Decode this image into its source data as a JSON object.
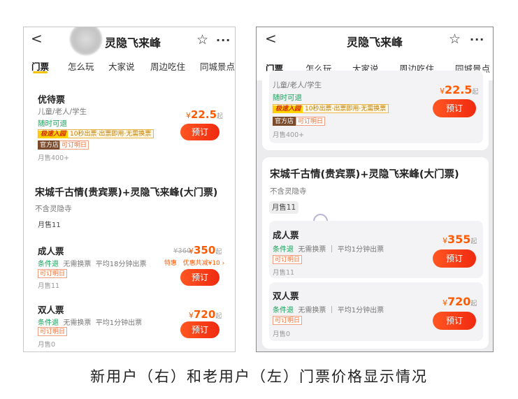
{
  "header": {
    "title": "灵隐飞来峰"
  },
  "tabs": [
    "门票",
    "怎么玩",
    "大家说",
    "周边吃住",
    "同城景点"
  ],
  "icons": {
    "back": "back-arrow-icon",
    "favorite": "star-icon",
    "more": "more-icon"
  },
  "colors": {
    "accent": "#f5c400",
    "price": "#ff5a00",
    "button": "#f0361a",
    "green": "#1aa05a"
  },
  "left": {
    "youdai": {
      "name": "优待票",
      "audience": "儿童/老人/学生",
      "refund": "随时可退",
      "fast_tag": "极速入园",
      "fast_text": "10秒出票·出票即用·无需换票",
      "shop": "官方店",
      "book": "可订明日",
      "sales": "月售400+",
      "currency": "¥",
      "price": "22.5",
      "unit": "起",
      "button": "预订"
    },
    "combo": {
      "title": "宋城千古情(贵宾票)+灵隐飞来峰(大门票)",
      "note": "不含灵隐寺",
      "sales": "月售11",
      "adult": {
        "name": "成人票",
        "refund": "条件退",
        "exchange": "无需换票",
        "speed": "平均18分钟出票",
        "book": "可订明日",
        "sales": "月售11",
        "orig": "¥360",
        "currency": "¥",
        "price": "350",
        "unit": "起",
        "special": "特惠",
        "discount": "优惠共减¥10",
        "button": "预订"
      },
      "double": {
        "name": "双人票",
        "refund": "条件退",
        "exchange": "无需换票",
        "speed": "平均1分钟出票",
        "book": "可订明日",
        "sales": "月售0",
        "currency": "¥",
        "price": "720",
        "unit": "起",
        "button": "预订"
      }
    }
  },
  "right": {
    "youdai": {
      "audience": "儿童/老人/学生",
      "refund": "随时可退",
      "fast_tag": "极速入园",
      "fast_text": "10秒出票·出票即用·无需换票",
      "shop": "官方店",
      "book": "可订明日",
      "sales": "月售400+",
      "currency": "¥",
      "price": "22.5",
      "unit": "起",
      "button": "预订"
    },
    "combo": {
      "title": "宋城千古情(贵宾票)+灵隐飞来峰(大门票)",
      "note": "不含灵隐寺",
      "sales": "月售11",
      "adult": {
        "name": "成人票",
        "refund": "条件退",
        "exchange": "无需换票",
        "speed": "平均1分钟出票",
        "book": "可订明日",
        "sales": "月售11",
        "currency": "¥",
        "price": "355",
        "unit": "起",
        "button": "预订"
      },
      "double": {
        "name": "双人票",
        "refund": "条件退",
        "exchange": "无需换票",
        "speed": "平均1分钟出票",
        "book": "可订明日",
        "sales": "月售0",
        "currency": "¥",
        "price": "720",
        "unit": "起",
        "button": "预订"
      }
    }
  },
  "caption": "新用户（右）和老用户（左）门票价格显示情况"
}
